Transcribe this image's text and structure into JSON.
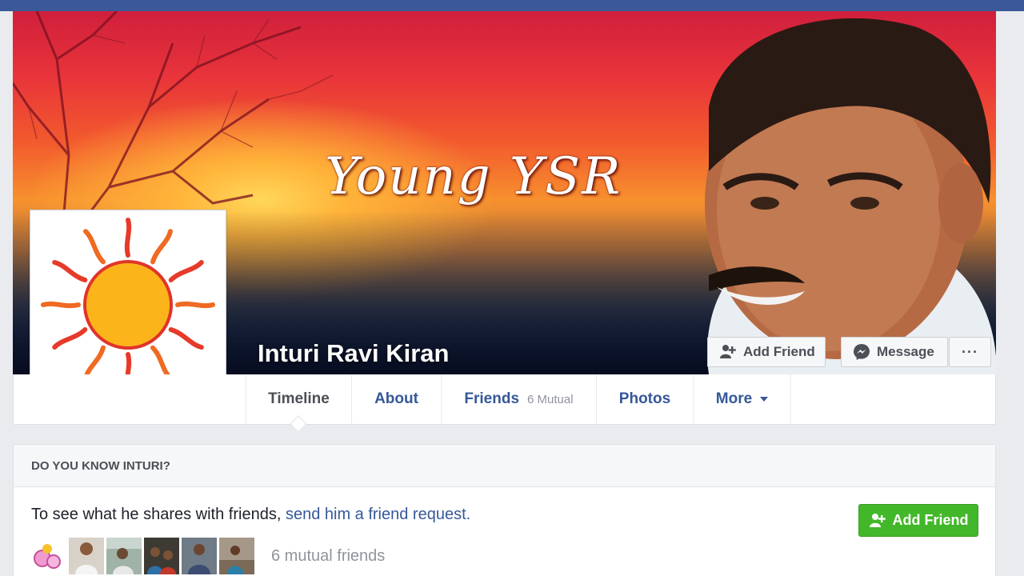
{
  "cover": {
    "script_text": "Young YSR",
    "profile_name": "Inturi Ravi Kiran",
    "add_friend_label": "Add Friend",
    "message_label": "Message",
    "more_label": "···"
  },
  "nav": {
    "tabs": [
      {
        "label": "Timeline"
      },
      {
        "label": "About"
      },
      {
        "label": "Friends",
        "sub": "6 Mutual"
      },
      {
        "label": "Photos"
      },
      {
        "label": "More"
      }
    ]
  },
  "card": {
    "header": "DO YOU KNOW INTURI?",
    "text_prefix": "To see what he shares with friends,",
    "text_link": "send him a friend request.",
    "add_friend_label": "Add Friend",
    "mutual_text": "6 mutual friends"
  },
  "colors": {
    "brand": "#3b5998",
    "link": "#365899",
    "green": "#42b72a"
  }
}
